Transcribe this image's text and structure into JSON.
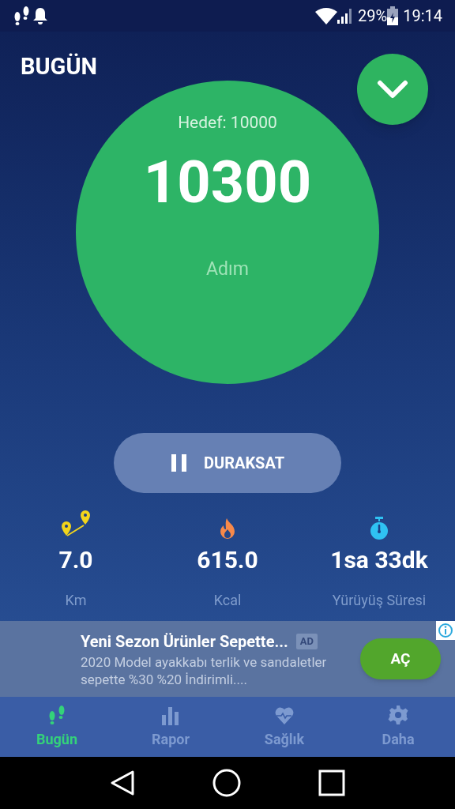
{
  "status_bar": {
    "battery": "29%",
    "time": "19:14"
  },
  "header": {
    "title": "BUGÜN"
  },
  "goal_circle": {
    "goal": "Hedef: 10000",
    "steps": "10300",
    "unit": "Adım"
  },
  "pause_button": {
    "label": "DURAKSAT"
  },
  "stats": [
    {
      "kind": "distance",
      "value": "7.0",
      "label": "Km"
    },
    {
      "kind": "calories",
      "value": "615.0",
      "label": "Kcal"
    },
    {
      "kind": "duration",
      "value": "1sa 33dk",
      "label": "Yürüyüş Süresi"
    }
  ],
  "ad": {
    "title": "Yeni Sezon Ürünler Sepette...",
    "badge": "AD",
    "text": "2020 Model ayakkabı terlik ve sandaletler sepette %30 %20 İndirimli....",
    "button": "AÇ"
  },
  "nav": [
    {
      "kind": "steps",
      "label": "Bugün",
      "selected": true
    },
    {
      "kind": "report",
      "label": "Rapor",
      "selected": false
    },
    {
      "kind": "health",
      "label": "Sağlık",
      "selected": false
    },
    {
      "kind": "more",
      "label": "Daha",
      "selected": false
    }
  ]
}
